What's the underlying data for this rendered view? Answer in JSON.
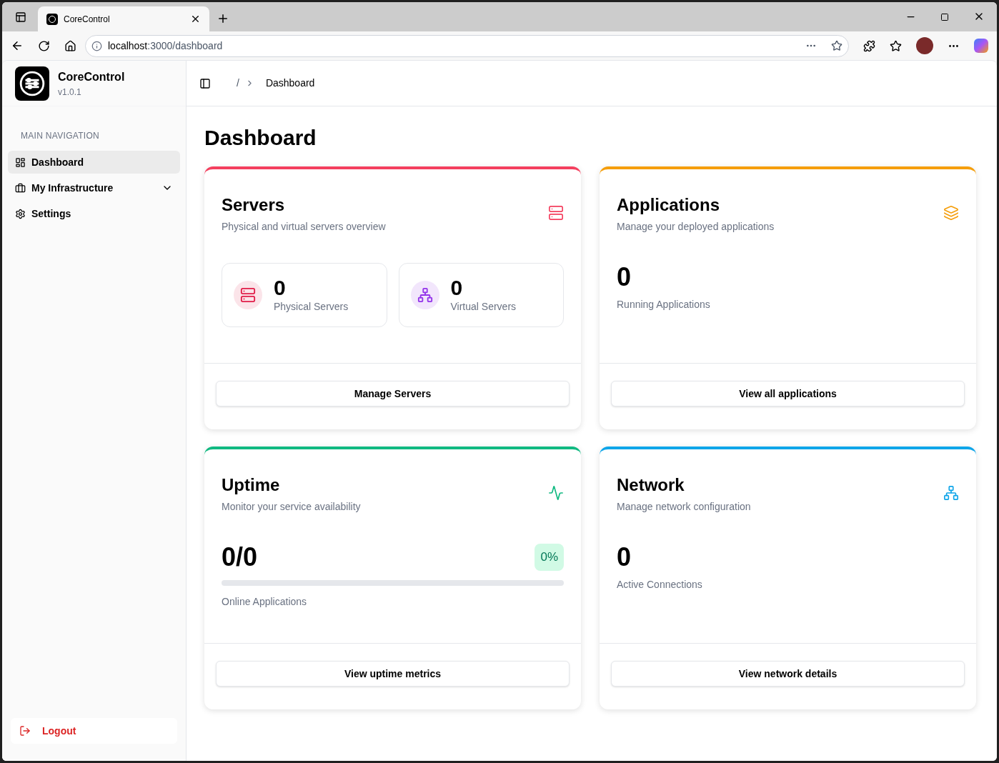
{
  "browser": {
    "tab_title": "CoreControl",
    "url_host": "localhost",
    "url_path": ":3000/dashboard"
  },
  "sidebar": {
    "app_name": "CoreControl",
    "version": "v1.0.1",
    "section_label": "MAIN NAVIGATION",
    "items": [
      {
        "label": "Dashboard",
        "selected": true,
        "expandable": false
      },
      {
        "label": "My Infrastructure",
        "selected": false,
        "expandable": true
      },
      {
        "label": "Settings",
        "selected": false,
        "expandable": false
      }
    ],
    "logout": "Logout"
  },
  "breadcrumb": {
    "separator": "/",
    "current": "Dashboard"
  },
  "page_title": "Dashboard",
  "cards": [
    {
      "kind": "servers",
      "title": "Servers",
      "subtitle": "Physical and virtual servers overview",
      "color": "#f43f5e",
      "button": "Manage Servers",
      "stats": [
        {
          "value": "0",
          "label": "Physical Servers",
          "color": "#e11d48"
        },
        {
          "value": "0",
          "label": "Virtual Servers",
          "color": "#9333ea"
        }
      ]
    },
    {
      "kind": "stat",
      "title": "Applications",
      "subtitle": "Manage your deployed applications",
      "color": "#f59e0b",
      "button": "View all applications",
      "value": "0",
      "label": "Running Applications"
    },
    {
      "kind": "uptime",
      "title": "Uptime",
      "subtitle": "Monitor your service availability",
      "color": "#10b981",
      "button": "View uptime metrics",
      "value": "0/0",
      "badge": "0%",
      "level": 0,
      "label": "Online Applications"
    },
    {
      "kind": "stat",
      "title": "Network",
      "subtitle": "Manage network configuration",
      "color": "#0ea5e9",
      "button": "View network details",
      "value": "0",
      "label": "Active Connections"
    }
  ]
}
